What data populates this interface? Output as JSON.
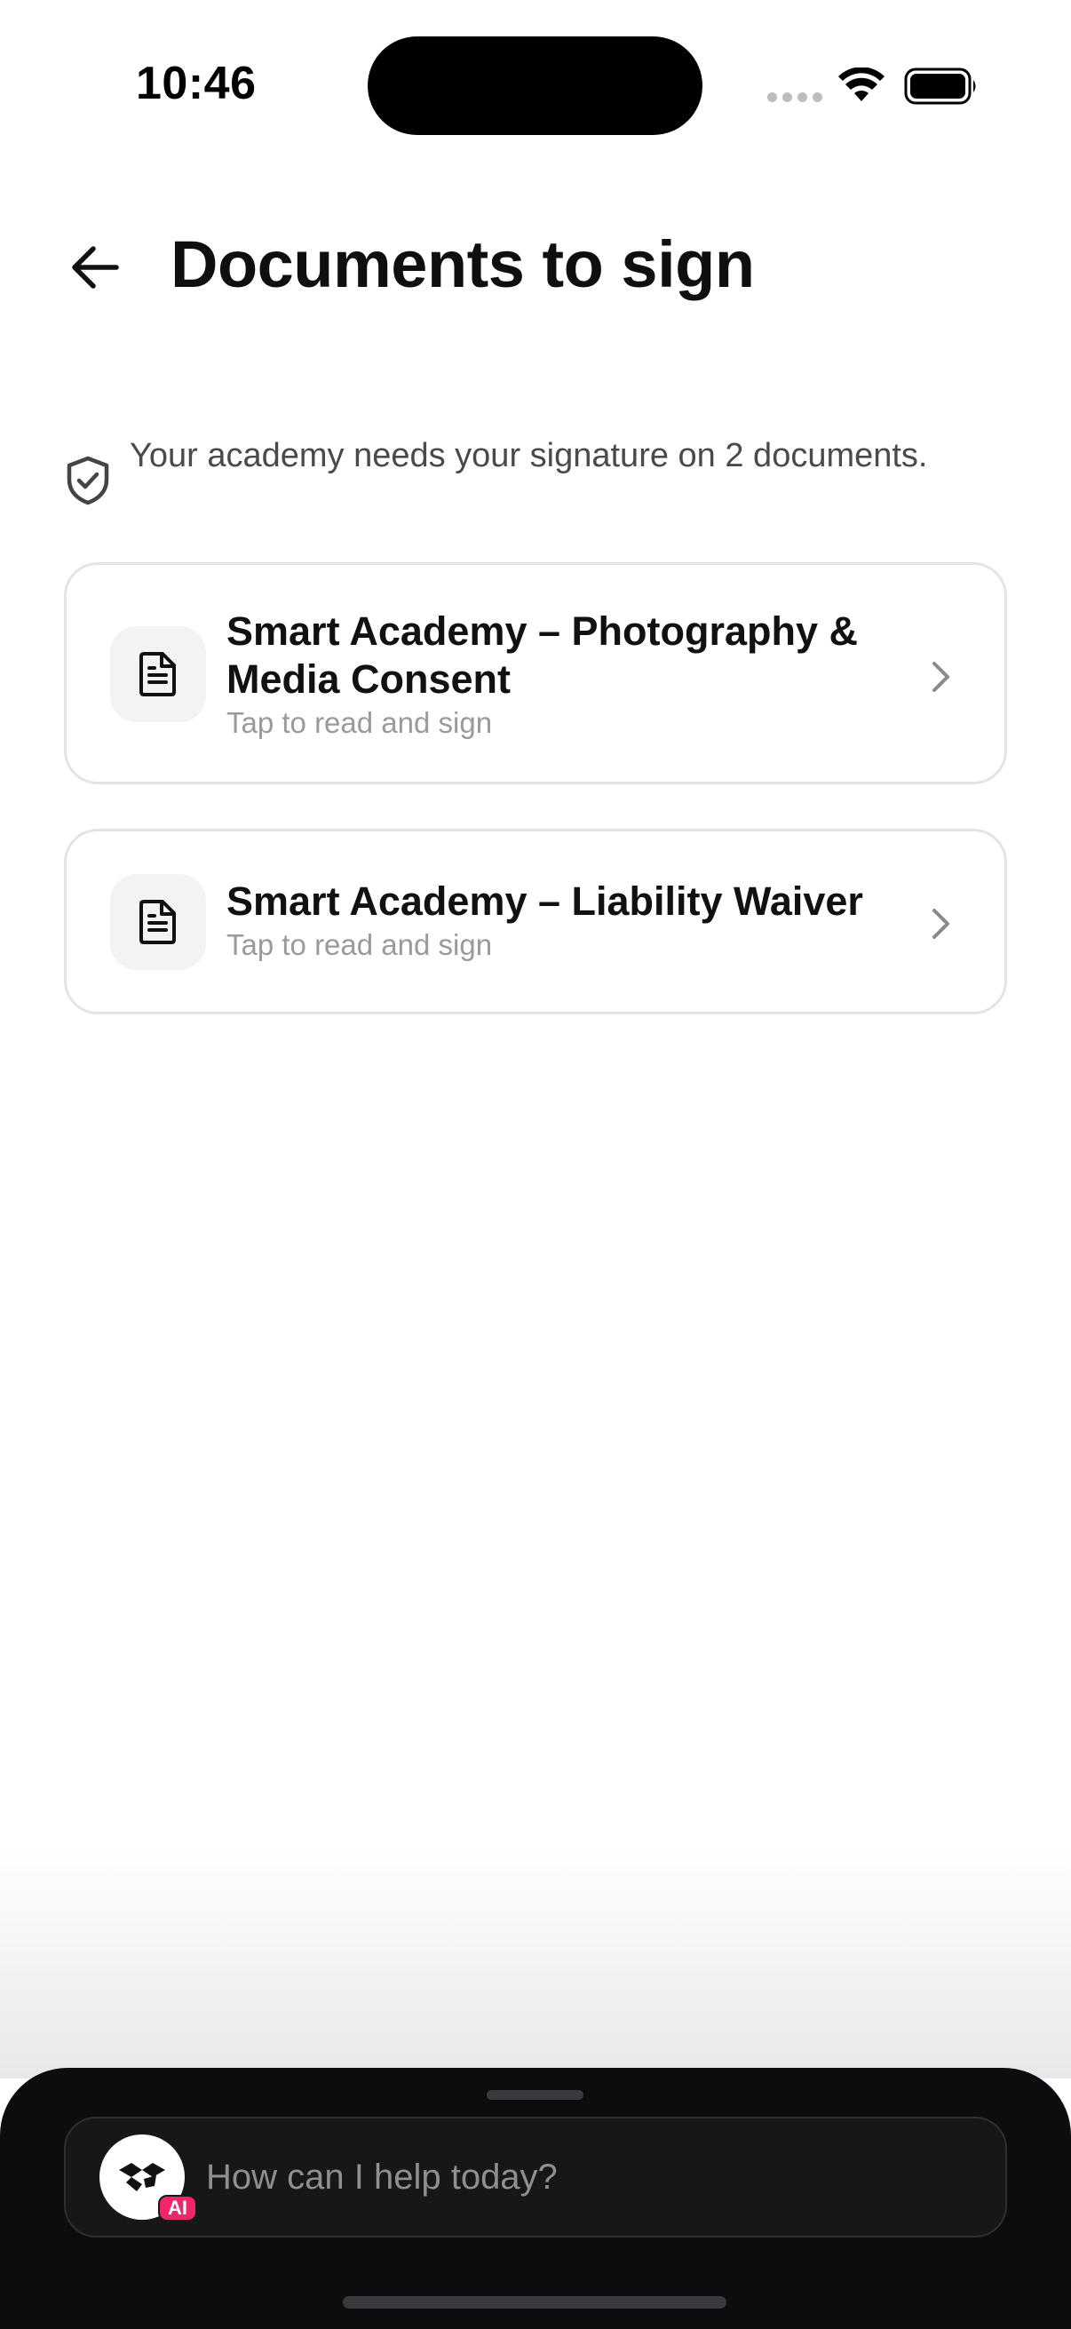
{
  "status_bar": {
    "time": "10:46",
    "signal": "signal-dots-icon",
    "wifi": "wifi-icon",
    "battery": "battery-icon"
  },
  "header": {
    "back_icon": "arrow-left-icon",
    "title": "Documents to sign"
  },
  "notice": {
    "icon": "shield-check-icon",
    "text": "Your academy needs your signature on 2 documents."
  },
  "documents": [
    {
      "icon": "document-icon",
      "title": "Smart Academy – Photography & Media Consent",
      "subtitle": "Tap to read and sign",
      "chevron": "chevron-right-icon"
    },
    {
      "icon": "document-icon",
      "title": "Smart Academy – Liability Waiver",
      "subtitle": "Tap to read and sign",
      "chevron": "chevron-right-icon"
    }
  ],
  "assistant": {
    "avatar_icon": "assistant-logo-icon",
    "badge": "AI",
    "placeholder": "How can I help today?"
  },
  "colors": {
    "badge": "#f0256a",
    "sheet": "#0d0d0f",
    "card_border": "#e4e4e7"
  }
}
